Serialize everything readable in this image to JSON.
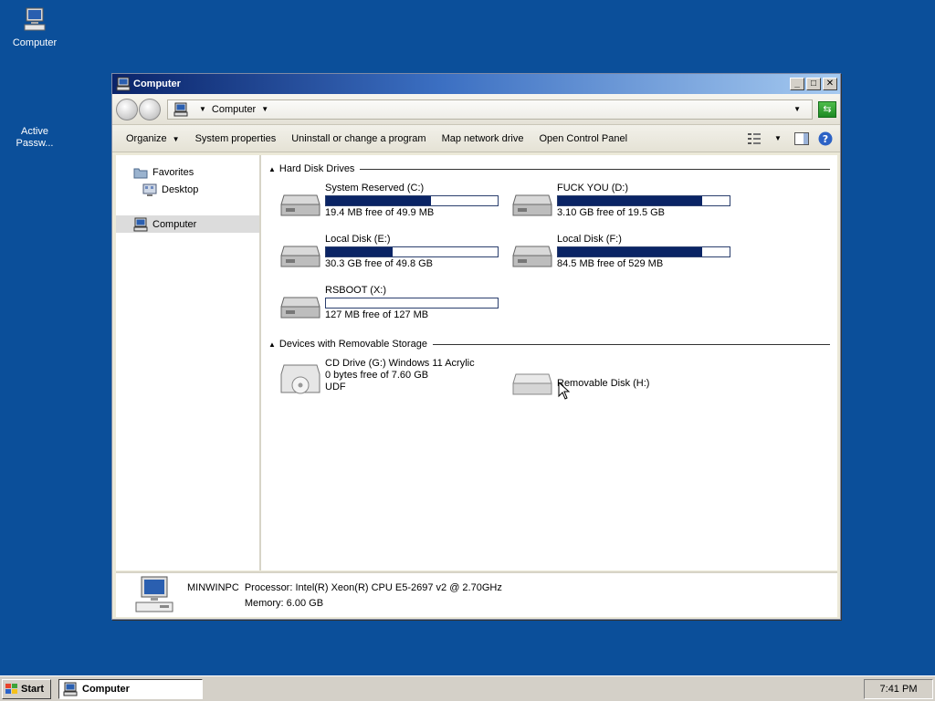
{
  "desktop": {
    "icons": [
      {
        "label": "Computer"
      },
      {
        "label": "Active\nPassw..."
      }
    ]
  },
  "window": {
    "title": "Computer",
    "controls": {
      "minimize": "_",
      "maximize": "□",
      "close": "✕"
    }
  },
  "address": {
    "location": "Computer"
  },
  "toolbar": {
    "organize": "Organize",
    "system_properties": "System properties",
    "uninstall": "Uninstall or change a program",
    "map_drive": "Map network drive",
    "control_panel": "Open Control Panel"
  },
  "nav": {
    "favorites": "Favorites",
    "desktop": "Desktop",
    "computer": "Computer"
  },
  "groups": {
    "hdd_header": "Hard Disk Drives",
    "removable_header": "Devices with Removable Storage"
  },
  "drives": [
    {
      "name": "System Reserved (C:)",
      "free": "19.4 MB free of 49.9 MB",
      "used_fraction": 0.61
    },
    {
      "name": "FUCK YOU (D:)",
      "free": "3.10 GB free of 19.5 GB",
      "used_fraction": 0.84
    },
    {
      "name": "Local Disk (E:)",
      "free": "30.3 GB free of 49.8 GB",
      "used_fraction": 0.39
    },
    {
      "name": "Local Disk (F:)",
      "free": "84.5 MB free of 529 MB",
      "used_fraction": 0.84
    },
    {
      "name": "RSBOOT (X:)",
      "free": "127 MB free of 127 MB",
      "used_fraction": 0.0
    }
  ],
  "removable": [
    {
      "name": "CD Drive (G:) Windows 11 Acrylic",
      "free": "0 bytes free of 7.60 GB",
      "fs": "UDF"
    },
    {
      "name": "Removable Disk (H:)"
    }
  ],
  "details": {
    "computer_name": "MINWINPC",
    "processor_label": "Processor:",
    "processor_value": "Intel(R) Xeon(R) CPU E5-2697 v2 @ 2.70GHz",
    "memory_label": "Memory:",
    "memory_value": "6.00 GB"
  },
  "taskbar": {
    "start": "Start",
    "task_label": "Computer",
    "clock": "7:41 PM"
  },
  "colors": {
    "desktop": "#0b4f9a",
    "bar_fill": "#0a2465"
  }
}
